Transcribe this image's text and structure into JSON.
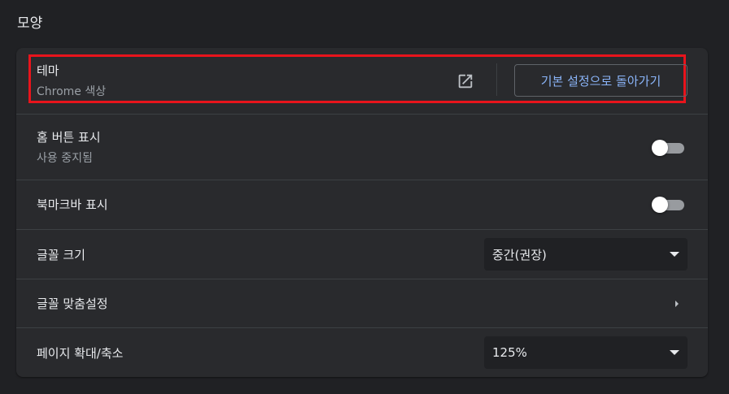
{
  "section": {
    "title": "모양"
  },
  "theme": {
    "label": "테마",
    "sublabel": "Chrome 색상",
    "external_icon": "open-in-new-icon",
    "reset_button": "기본 설정으로 돌아가기"
  },
  "home_button": {
    "label": "홈 버튼 표시",
    "sublabel": "사용 중지됨",
    "enabled": false
  },
  "bookmarks_bar": {
    "label": "북마크바 표시",
    "enabled": false
  },
  "font_size": {
    "label": "글꼴 크기",
    "selected": "중간(권장)"
  },
  "customize_fonts": {
    "label": "글꼴 맞춤설정",
    "icon": "chevron-right-icon"
  },
  "page_zoom": {
    "label": "페이지 확대/축소",
    "selected": "125%"
  },
  "colors": {
    "background": "#202124",
    "card": "#292a2d",
    "divider": "#3c4043",
    "accent": "#8ab4f8",
    "highlight": "#e8141c"
  }
}
